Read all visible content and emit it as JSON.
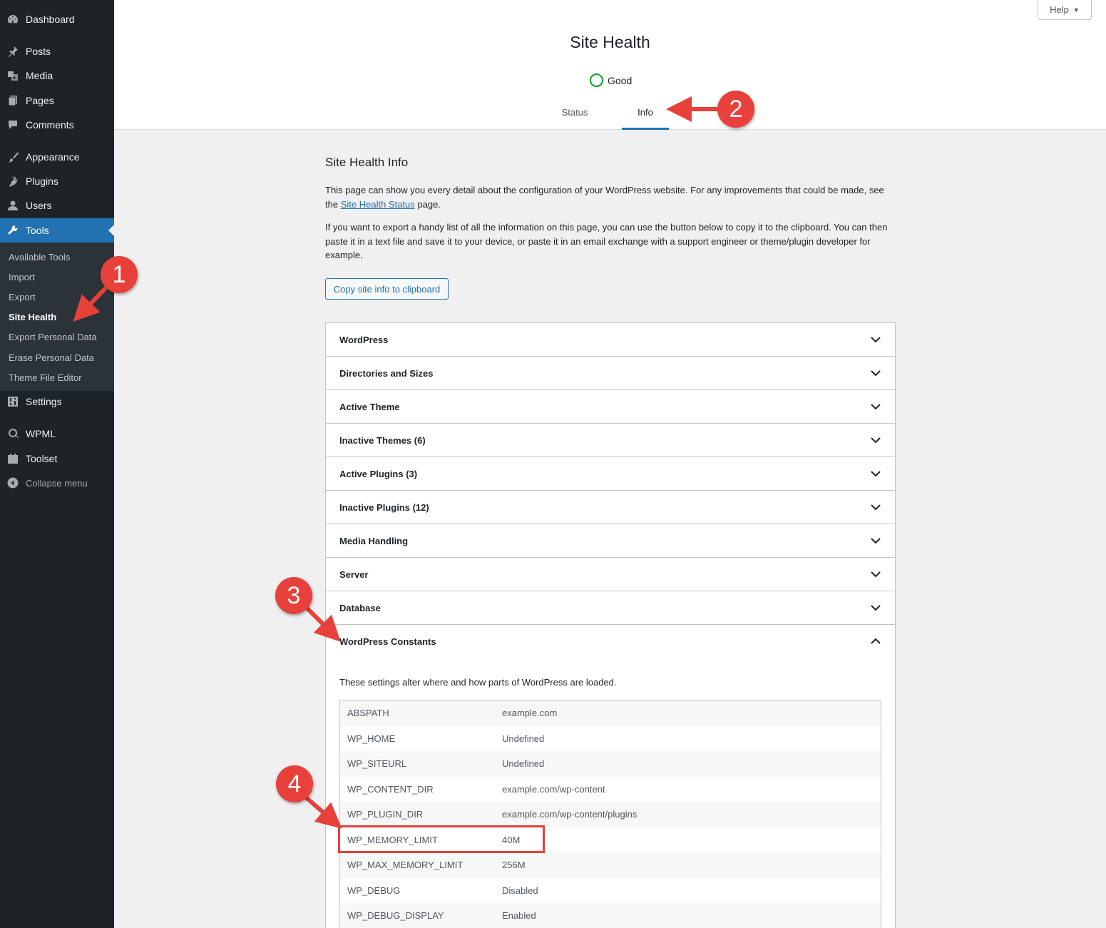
{
  "sidebar": {
    "items": [
      {
        "label": "Dashboard",
        "icon": "dashboard-icon"
      },
      {
        "label": "Posts",
        "icon": "pin-icon"
      },
      {
        "label": "Media",
        "icon": "media-icon"
      },
      {
        "label": "Pages",
        "icon": "pages-icon"
      },
      {
        "label": "Comments",
        "icon": "comment-icon"
      },
      {
        "label": "Appearance",
        "icon": "brush-icon"
      },
      {
        "label": "Plugins",
        "icon": "plugin-icon"
      },
      {
        "label": "Users",
        "icon": "user-icon"
      },
      {
        "label": "Tools",
        "icon": "wrench-icon"
      },
      {
        "label": "Settings",
        "icon": "settings-icon"
      },
      {
        "label": "WPML",
        "icon": "wpml-icon"
      },
      {
        "label": "Toolset",
        "icon": "toolset-icon"
      },
      {
        "label": "Collapse menu",
        "icon": "collapse-icon"
      }
    ],
    "submenu": [
      "Available Tools",
      "Import",
      "Export",
      "Site Health",
      "Export Personal Data",
      "Erase Personal Data",
      "Theme File Editor"
    ],
    "active_item": "Tools",
    "current_subitem": "Site Health"
  },
  "header": {
    "help_label": "Help",
    "title": "Site Health",
    "status_label": "Good",
    "tabs": [
      {
        "label": "Status"
      },
      {
        "label": "Info"
      }
    ],
    "active_tab": "Info"
  },
  "main": {
    "title": "Site Health Info",
    "para1_a": "This page can show you every detail about the configuration of your WordPress website. For any improvements that could be made, see the",
    "para1_link": "Site Health Status",
    "para1_b": "page.",
    "para2": "If you want to export a handy list of all the information on this page, you can use the button below to copy it to the clipboard. You can then paste it in a text file and save it to your device, or paste it in an email exchange with a support engineer or theme/plugin developer for example.",
    "copy_button": "Copy site info to clipboard",
    "sections": [
      "WordPress",
      "Directories and Sizes",
      "Active Theme",
      "Inactive Themes (6)",
      "Active Plugins (3)",
      "Inactive Plugins (12)",
      "Media Handling",
      "Server",
      "Database",
      "WordPress Constants"
    ],
    "constants_description": "These settings alter where and how parts of WordPress are loaded.",
    "constants": [
      {
        "key": "ABSPATH",
        "value": "example.com"
      },
      {
        "key": "WP_HOME",
        "value": "Undefined"
      },
      {
        "key": "WP_SITEURL",
        "value": "Undefined"
      },
      {
        "key": "WP_CONTENT_DIR",
        "value": "example.com/wp-content"
      },
      {
        "key": "WP_PLUGIN_DIR",
        "value": "example.com/wp-content/plugins"
      },
      {
        "key": "WP_MEMORY_LIMIT",
        "value": "40M"
      },
      {
        "key": "WP_MAX_MEMORY_LIMIT",
        "value": "256M"
      },
      {
        "key": "WP_DEBUG",
        "value": "Disabled"
      },
      {
        "key": "WP_DEBUG_DISPLAY",
        "value": "Enabled"
      }
    ]
  },
  "annotations": [
    "1",
    "2",
    "3",
    "4"
  ],
  "colors": {
    "sidebar_bg": "#1d2327",
    "submenu_bg": "#2c3338",
    "accent": "#2271b1",
    "good": "#00a32a",
    "annotation": "#e8403a"
  }
}
